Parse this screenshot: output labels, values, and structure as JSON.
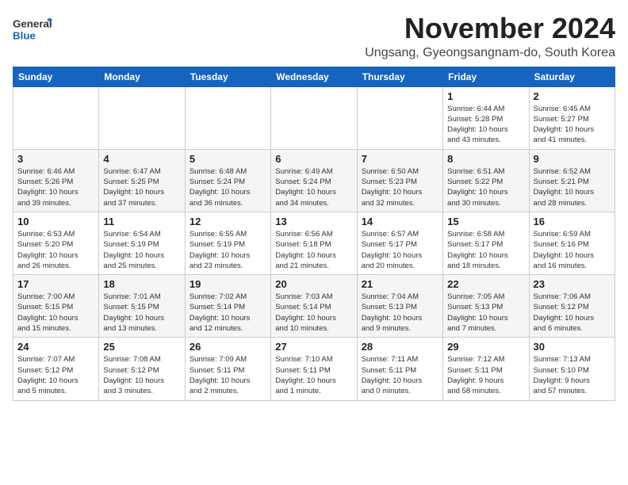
{
  "header": {
    "logo_line1": "General",
    "logo_line2": "Blue",
    "month": "November 2024",
    "location": "Ungsang, Gyeongsangnam-do, South Korea"
  },
  "weekdays": [
    "Sunday",
    "Monday",
    "Tuesday",
    "Wednesday",
    "Thursday",
    "Friday",
    "Saturday"
  ],
  "weeks": [
    [
      {
        "day": "",
        "info": ""
      },
      {
        "day": "",
        "info": ""
      },
      {
        "day": "",
        "info": ""
      },
      {
        "day": "",
        "info": ""
      },
      {
        "day": "",
        "info": ""
      },
      {
        "day": "1",
        "info": "Sunrise: 6:44 AM\nSunset: 5:28 PM\nDaylight: 10 hours\nand 43 minutes."
      },
      {
        "day": "2",
        "info": "Sunrise: 6:45 AM\nSunset: 5:27 PM\nDaylight: 10 hours\nand 41 minutes."
      }
    ],
    [
      {
        "day": "3",
        "info": "Sunrise: 6:46 AM\nSunset: 5:26 PM\nDaylight: 10 hours\nand 39 minutes."
      },
      {
        "day": "4",
        "info": "Sunrise: 6:47 AM\nSunset: 5:25 PM\nDaylight: 10 hours\nand 37 minutes."
      },
      {
        "day": "5",
        "info": "Sunrise: 6:48 AM\nSunset: 5:24 PM\nDaylight: 10 hours\nand 36 minutes."
      },
      {
        "day": "6",
        "info": "Sunrise: 6:49 AM\nSunset: 5:24 PM\nDaylight: 10 hours\nand 34 minutes."
      },
      {
        "day": "7",
        "info": "Sunrise: 6:50 AM\nSunset: 5:23 PM\nDaylight: 10 hours\nand 32 minutes."
      },
      {
        "day": "8",
        "info": "Sunrise: 6:51 AM\nSunset: 5:22 PM\nDaylight: 10 hours\nand 30 minutes."
      },
      {
        "day": "9",
        "info": "Sunrise: 6:52 AM\nSunset: 5:21 PM\nDaylight: 10 hours\nand 28 minutes."
      }
    ],
    [
      {
        "day": "10",
        "info": "Sunrise: 6:53 AM\nSunset: 5:20 PM\nDaylight: 10 hours\nand 26 minutes."
      },
      {
        "day": "11",
        "info": "Sunrise: 6:54 AM\nSunset: 5:19 PM\nDaylight: 10 hours\nand 25 minutes."
      },
      {
        "day": "12",
        "info": "Sunrise: 6:55 AM\nSunset: 5:19 PM\nDaylight: 10 hours\nand 23 minutes."
      },
      {
        "day": "13",
        "info": "Sunrise: 6:56 AM\nSunset: 5:18 PM\nDaylight: 10 hours\nand 21 minutes."
      },
      {
        "day": "14",
        "info": "Sunrise: 6:57 AM\nSunset: 5:17 PM\nDaylight: 10 hours\nand 20 minutes."
      },
      {
        "day": "15",
        "info": "Sunrise: 6:58 AM\nSunset: 5:17 PM\nDaylight: 10 hours\nand 18 minutes."
      },
      {
        "day": "16",
        "info": "Sunrise: 6:59 AM\nSunset: 5:16 PM\nDaylight: 10 hours\nand 16 minutes."
      }
    ],
    [
      {
        "day": "17",
        "info": "Sunrise: 7:00 AM\nSunset: 5:15 PM\nDaylight: 10 hours\nand 15 minutes."
      },
      {
        "day": "18",
        "info": "Sunrise: 7:01 AM\nSunset: 5:15 PM\nDaylight: 10 hours\nand 13 minutes."
      },
      {
        "day": "19",
        "info": "Sunrise: 7:02 AM\nSunset: 5:14 PM\nDaylight: 10 hours\nand 12 minutes."
      },
      {
        "day": "20",
        "info": "Sunrise: 7:03 AM\nSunset: 5:14 PM\nDaylight: 10 hours\nand 10 minutes."
      },
      {
        "day": "21",
        "info": "Sunrise: 7:04 AM\nSunset: 5:13 PM\nDaylight: 10 hours\nand 9 minutes."
      },
      {
        "day": "22",
        "info": "Sunrise: 7:05 AM\nSunset: 5:13 PM\nDaylight: 10 hours\nand 7 minutes."
      },
      {
        "day": "23",
        "info": "Sunrise: 7:06 AM\nSunset: 5:12 PM\nDaylight: 10 hours\nand 6 minutes."
      }
    ],
    [
      {
        "day": "24",
        "info": "Sunrise: 7:07 AM\nSunset: 5:12 PM\nDaylight: 10 hours\nand 5 minutes."
      },
      {
        "day": "25",
        "info": "Sunrise: 7:08 AM\nSunset: 5:12 PM\nDaylight: 10 hours\nand 3 minutes."
      },
      {
        "day": "26",
        "info": "Sunrise: 7:09 AM\nSunset: 5:11 PM\nDaylight: 10 hours\nand 2 minutes."
      },
      {
        "day": "27",
        "info": "Sunrise: 7:10 AM\nSunset: 5:11 PM\nDaylight: 10 hours\nand 1 minute."
      },
      {
        "day": "28",
        "info": "Sunrise: 7:11 AM\nSunset: 5:11 PM\nDaylight: 10 hours\nand 0 minutes."
      },
      {
        "day": "29",
        "info": "Sunrise: 7:12 AM\nSunset: 5:11 PM\nDaylight: 9 hours\nand 58 minutes."
      },
      {
        "day": "30",
        "info": "Sunrise: 7:13 AM\nSunset: 5:10 PM\nDaylight: 9 hours\nand 57 minutes."
      }
    ]
  ]
}
